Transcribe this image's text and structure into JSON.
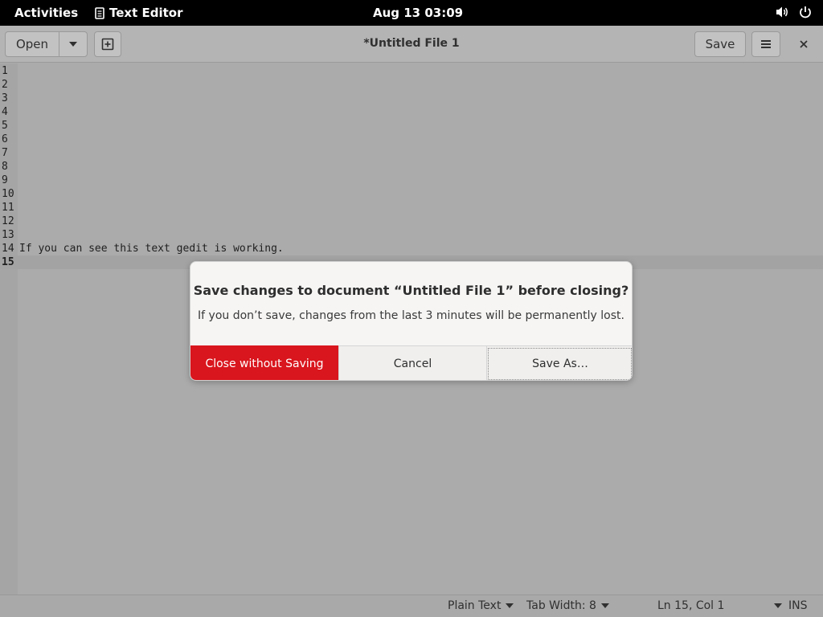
{
  "topbar": {
    "activities": "Activities",
    "app_name": "Text Editor",
    "clock": "Aug 13  03:09",
    "icons": [
      "volume-icon",
      "power-icon"
    ]
  },
  "headerbar": {
    "open_label": "Open",
    "title": "*Untitled File 1",
    "save_label": "Save",
    "icons": [
      "chevron-down-icon",
      "new-tab-icon",
      "hamburger-menu-icon",
      "close-icon"
    ]
  },
  "editor": {
    "lines": [
      {
        "num": "1",
        "text": ""
      },
      {
        "num": "2",
        "text": ""
      },
      {
        "num": "3",
        "text": ""
      },
      {
        "num": "4",
        "text": ""
      },
      {
        "num": "5",
        "text": ""
      },
      {
        "num": "6",
        "text": ""
      },
      {
        "num": "7",
        "text": ""
      },
      {
        "num": "8",
        "text": ""
      },
      {
        "num": "9",
        "text": ""
      },
      {
        "num": "10",
        "text": ""
      },
      {
        "num": "11",
        "text": ""
      },
      {
        "num": "12",
        "text": ""
      },
      {
        "num": "13",
        "text": ""
      },
      {
        "num": "14",
        "text": "If you can see this text gedit is working."
      },
      {
        "num": "15",
        "text": ""
      }
    ],
    "current_line": 15
  },
  "statusbar": {
    "language": "Plain Text",
    "tab_width": "Tab Width: 8",
    "position": "Ln 15, Col 1",
    "mode": "INS"
  },
  "dialog": {
    "heading": "Save changes to document “Untitled File 1” before closing?",
    "body": "If you don’t save, changes from the last 3 minutes will be permanently lost.",
    "close_without_saving": "Close without Saving",
    "cancel": "Cancel",
    "save_as": "Save As…"
  },
  "colors": {
    "destructive": "#d9151d",
    "topbar_bg": "#000000",
    "dim_bg": "#ababab"
  }
}
